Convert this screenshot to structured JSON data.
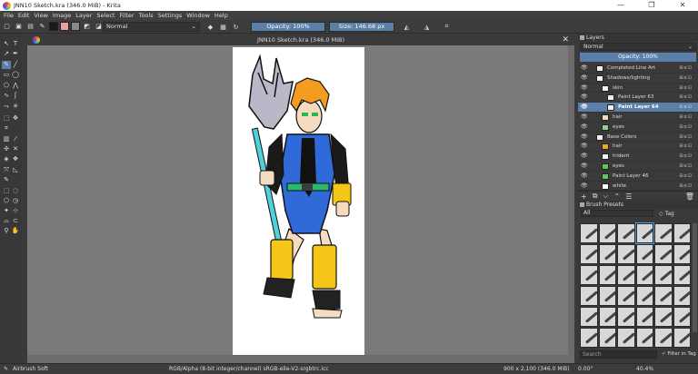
{
  "window": {
    "title": "JNN10 Sketch.kra (346.0 MiB)  - Krita",
    "controls": [
      "—",
      "❐",
      "✕"
    ]
  },
  "menu": [
    "File",
    "Edit",
    "View",
    "Image",
    "Layer",
    "Select",
    "Filter",
    "Tools",
    "Settings",
    "Window",
    "Help"
  ],
  "toolbar": {
    "blend_mode": "Normal",
    "opacity_label": "Opacity: 100%",
    "opacity_value": 1.0,
    "size_label": "Size: 146.68 px",
    "colors": {
      "fg": "#1a1a1a",
      "pattern": "#e8a0a0",
      "gradient": "#888888",
      "accent": "#5a7fa8"
    }
  },
  "document": {
    "tab_title": "JNN10 Sketch.kra (346.0 MiB)"
  },
  "layers_panel": {
    "title": "Layers",
    "blend_mode": "Normal",
    "opacity_label": "Opacity:  100%",
    "layers": [
      {
        "name": "Completed Line Art",
        "indent": 1,
        "thumb": "#f0f0f0",
        "selected": false
      },
      {
        "name": "Shadows/lighting",
        "indent": 1,
        "thumb": "#f0f0f0",
        "selected": false
      },
      {
        "name": "skin",
        "indent": 2,
        "thumb": "#f0f0f0",
        "selected": false
      },
      {
        "name": "Paint Layer 63",
        "indent": 3,
        "thumb": "#f0f0f0",
        "selected": false
      },
      {
        "name": "Paint Layer 64",
        "indent": 3,
        "thumb": "#f0f0f0",
        "selected": true
      },
      {
        "name": "hair",
        "indent": 2,
        "thumb": "#f5d9c2",
        "selected": false
      },
      {
        "name": "eyes",
        "indent": 2,
        "thumb": "#8fd48f",
        "selected": false
      },
      {
        "name": "Base Colors",
        "indent": 1,
        "thumb": "#f0f0f0",
        "selected": false
      },
      {
        "name": "hair",
        "indent": 2,
        "thumb": "#f5a623",
        "selected": false
      },
      {
        "name": "trident",
        "indent": 2,
        "thumb": "#f0f0f0",
        "selected": false
      },
      {
        "name": "eyes",
        "indent": 2,
        "thumb": "#5ac85a",
        "selected": false
      },
      {
        "name": "Paint Layer 46",
        "indent": 2,
        "thumb": "#5ac85a",
        "selected": false
      },
      {
        "name": "white",
        "indent": 2,
        "thumb": "#ffffff",
        "selected": false
      }
    ],
    "actions": [
      "+",
      "⧉",
      "⌵",
      "⌃",
      "☰",
      "🗑"
    ]
  },
  "brush_presets": {
    "title": "Brush Presets",
    "filter": "All",
    "tag_label": "Tag",
    "search_placeholder": "Search",
    "filter_in_tag": "Filter in Tag",
    "count": 36
  },
  "status": {
    "brush": "Airbrush Soft",
    "color_info": "RGB/Alpha (8-bit integer/channel)  sRGB-elle-V2-srgbtrc.icc",
    "doc_size": "900 x 2,100 (346.0 MiB)",
    "rotation": "0.00°",
    "zoom": "40.4%"
  }
}
